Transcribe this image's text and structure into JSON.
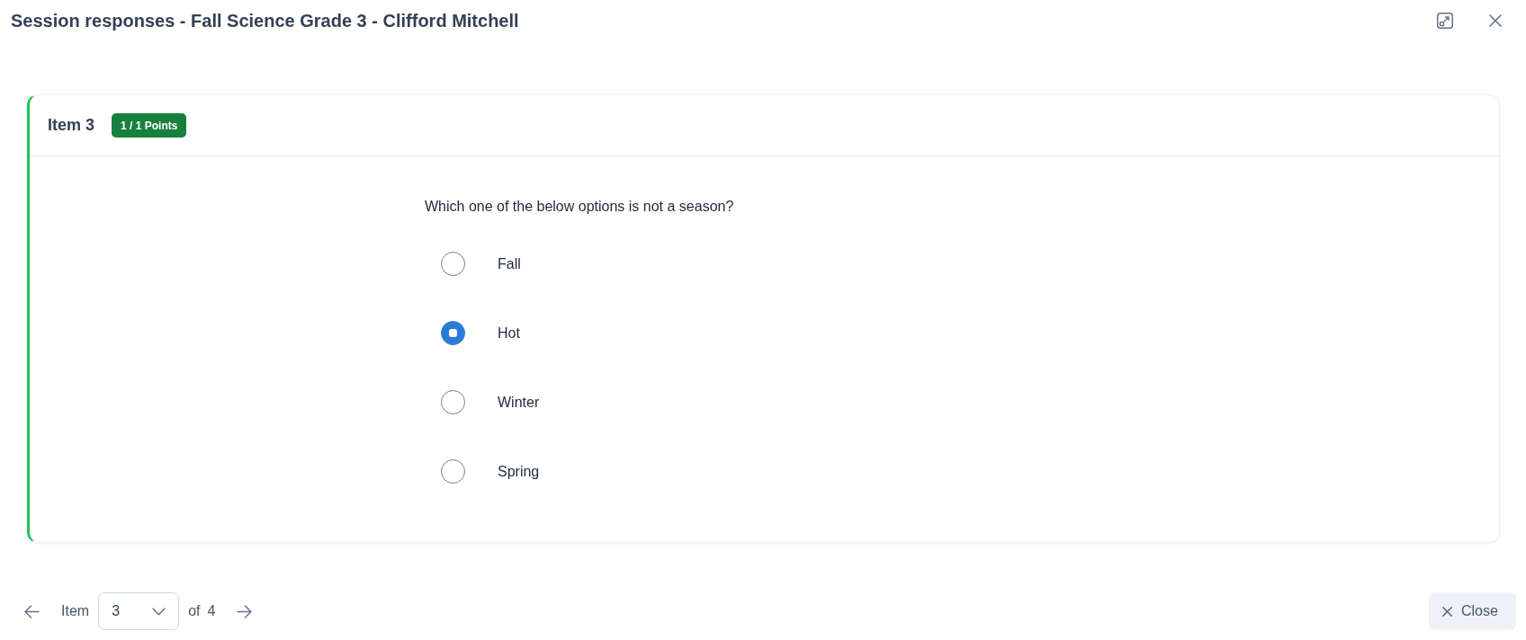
{
  "dialog": {
    "title": "Session responses - Fall Science Grade 3 - Clifford Mitchell"
  },
  "item": {
    "title": "Item 3",
    "score": "1 / 1 Points",
    "correct": true,
    "question": "Which one of the below options is not a season?",
    "options": [
      {
        "label": "Fall",
        "selected": false
      },
      {
        "label": "Hot",
        "selected": true
      },
      {
        "label": "Winter",
        "selected": false
      },
      {
        "label": "Spring",
        "selected": false
      }
    ]
  },
  "pager": {
    "label": "Item",
    "value": "3",
    "of_label": "of",
    "total": "4"
  },
  "footer": {
    "close_label": "Close"
  }
}
